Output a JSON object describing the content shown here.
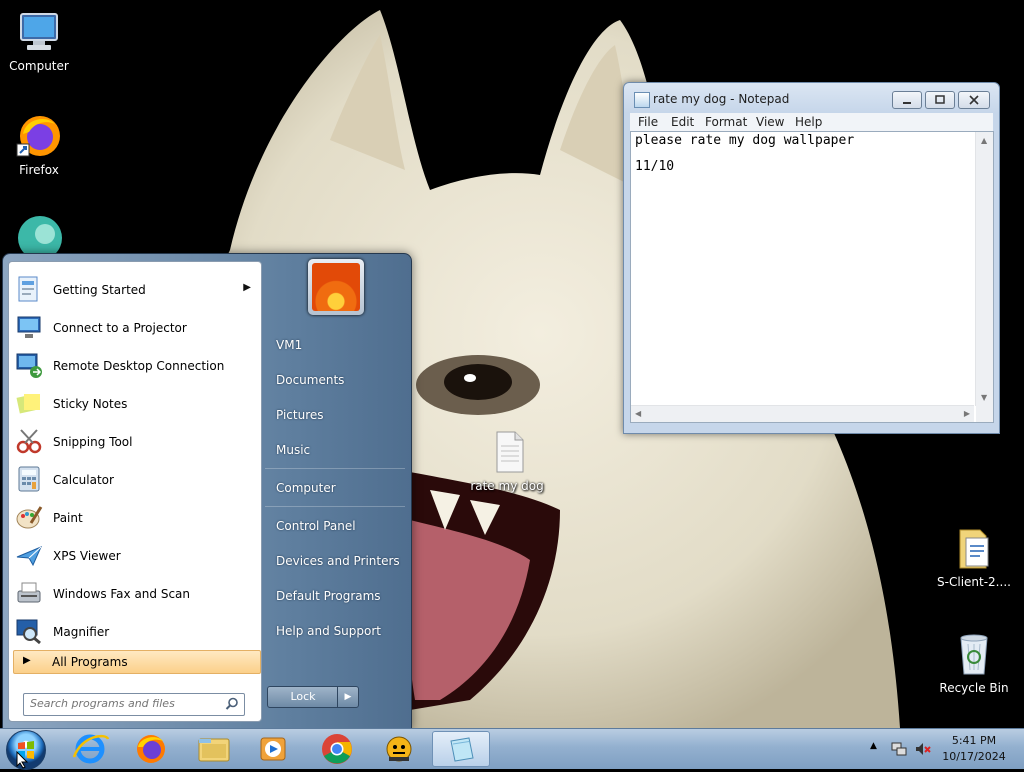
{
  "desktop": {
    "icons": [
      {
        "label": "Computer"
      },
      {
        "label": "Firefox"
      },
      {
        "label": "rate my dog"
      },
      {
        "label": "S-Client-2...."
      },
      {
        "label": "Recycle Bin"
      }
    ]
  },
  "notepad": {
    "title": "rate my dog - Notepad",
    "menu": [
      "File",
      "Edit",
      "Format",
      "View",
      "Help"
    ],
    "lines": [
      "please rate my dog wallpaper",
      "11/10"
    ]
  },
  "start_menu": {
    "programs": [
      {
        "label": "Getting Started",
        "icon": "getting-started-icon",
        "has_submenu": true
      },
      {
        "label": "Connect to a Projector",
        "icon": "projector-icon",
        "has_submenu": false
      },
      {
        "label": "Remote Desktop Connection",
        "icon": "remote-desktop-icon",
        "has_submenu": false
      },
      {
        "label": "Sticky Notes",
        "icon": "sticky-notes-icon",
        "has_submenu": false
      },
      {
        "label": "Snipping Tool",
        "icon": "snipping-tool-icon",
        "has_submenu": false
      },
      {
        "label": "Calculator",
        "icon": "calculator-icon",
        "has_submenu": false
      },
      {
        "label": "Paint",
        "icon": "paint-icon",
        "has_submenu": false
      },
      {
        "label": "XPS Viewer",
        "icon": "xps-viewer-icon",
        "has_submenu": false
      },
      {
        "label": "Windows Fax and Scan",
        "icon": "fax-scan-icon",
        "has_submenu": false
      },
      {
        "label": "Magnifier",
        "icon": "magnifier-icon",
        "has_submenu": false
      }
    ],
    "all_programs_label": "All Programs",
    "search_placeholder": "Search programs and files",
    "right_items": [
      "VM1",
      "Documents",
      "Pictures",
      "Music",
      "Computer",
      "Control Panel",
      "Devices and Printers",
      "Default Programs",
      "Help and Support"
    ],
    "lock_label": "Lock"
  },
  "taskbar": {
    "pinned": [
      "internet-explorer-icon",
      "firefox-icon",
      "file-explorer-icon",
      "media-player-icon",
      "chrome-icon",
      "app-icon",
      "notepad-icon"
    ],
    "clock_time": "5:41 PM",
    "clock_date": "10/17/2024"
  },
  "colors": {
    "taskbar": "#93b0cf",
    "start_menu_right": "#5f7f9f",
    "all_programs_highlight": "#fbd08a"
  }
}
